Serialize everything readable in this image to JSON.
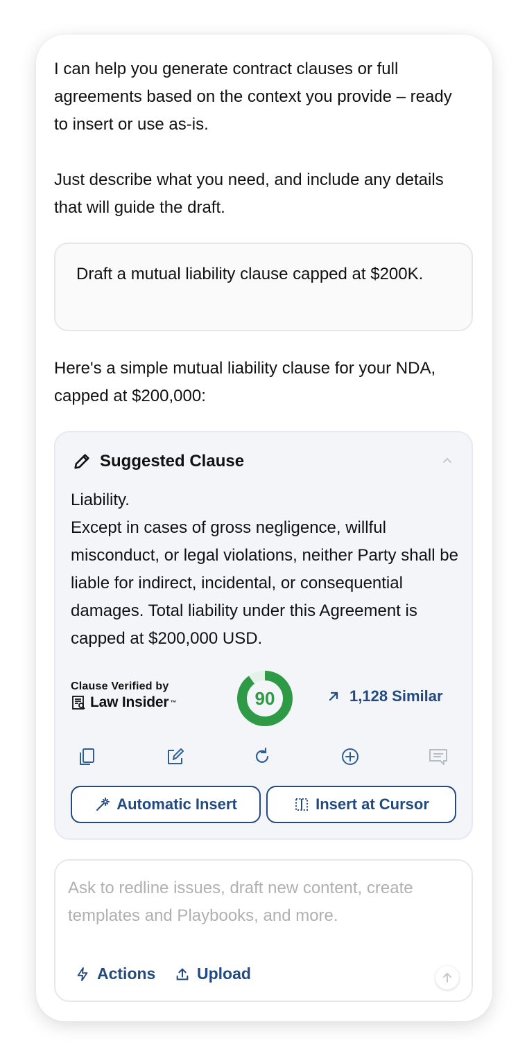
{
  "assistant": {
    "intro_paragraphs": [
      "I can help you generate contract clauses or full agreements based on the context you provide – ready to insert or use as-is.",
      "Just describe what you need, and include any details that will guide the draft."
    ],
    "reply": "Here's a simple mutual liability clause for your NDA, capped at $200,000:"
  },
  "user_message": "Draft a mutual liability clause capped at $200K.",
  "clause": {
    "title": "Suggested Clause",
    "heading": "Liability.",
    "text": "Except in cases of gross negligence, willful misconduct, or legal violations, neither Party shall be liable for indirect, incidental, or consequential damages. Total liability under this Agreement is capped at $200,000 USD.",
    "verified_label": "Clause Verified by",
    "verifier_name": "Law Insider",
    "verifier_tm": "™",
    "score": 90,
    "score_percent": 90,
    "similar_label": "1,128 Similar",
    "icons": [
      "copy-icon",
      "edit-icon",
      "regenerate-icon",
      "add-icon",
      "comment-icon"
    ],
    "buttons": {
      "automatic_insert": "Automatic Insert",
      "insert_at_cursor": "Insert at Cursor"
    }
  },
  "composer": {
    "placeholder": "Ask to redline issues, draft new content, create templates and Playbooks, and more.",
    "actions_label": "Actions",
    "upload_label": "Upload"
  },
  "colors": {
    "accent": "#234a80",
    "score_green": "#2e9a45",
    "card_bg": "#f3f5f9"
  }
}
